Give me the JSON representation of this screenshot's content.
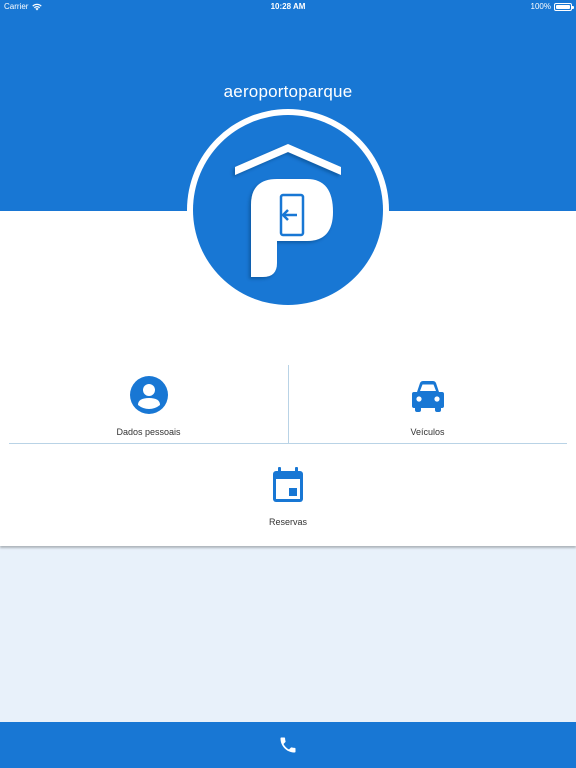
{
  "status_bar": {
    "carrier": "Carrier",
    "time": "10:28 AM",
    "battery": "100%",
    "battery_level": 1.0
  },
  "header": {
    "app_name": "aeroportoparque"
  },
  "menu": {
    "items": [
      {
        "label": "Dados pessoais",
        "icon": "person-icon"
      },
      {
        "label": "Veículos",
        "icon": "car-icon"
      },
      {
        "label": "Reservas",
        "icon": "calendar-icon"
      }
    ]
  },
  "footer": {
    "icon": "phone-icon"
  },
  "colors": {
    "primary": "#1877d4",
    "background": "#e8f1fa",
    "divider": "#b9d3e6",
    "text": "#333333"
  }
}
